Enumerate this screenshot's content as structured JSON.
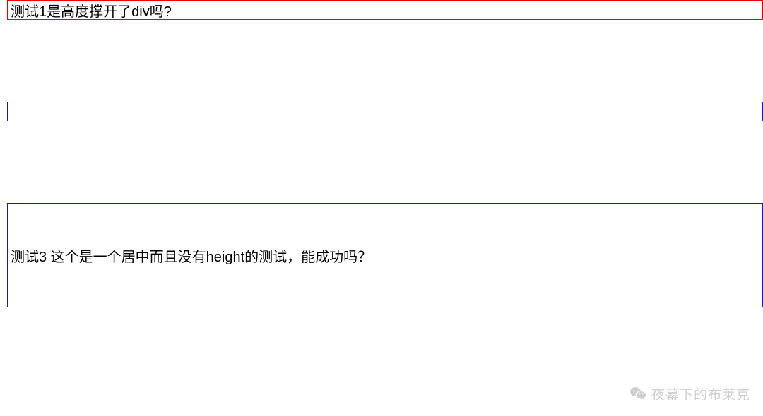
{
  "box1": {
    "text": "测试1是高度撑开了div吗?"
  },
  "box3": {
    "text": "测试3 这个是一个居中而且没有height的测试，能成功吗？"
  },
  "watermark": {
    "label": "夜幕下的布莱克"
  }
}
